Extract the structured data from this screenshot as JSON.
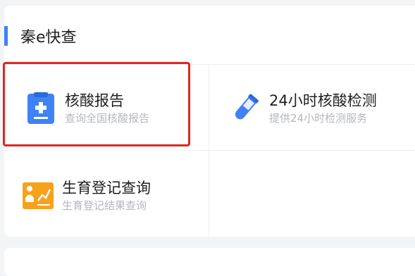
{
  "section": {
    "title": "秦e快查"
  },
  "services": [
    {
      "title": "核酸报告",
      "subtitle": "查询全国核酸报告",
      "icon": "clipboard-medical-icon",
      "color": "#3f82f7"
    },
    {
      "title": "24小时核酸检测",
      "subtitle": "提供24小时检测服务",
      "icon": "test-tube-icon",
      "color": "#3f82f7"
    },
    {
      "title": "生育登记查询",
      "subtitle": "生育登记结果查询",
      "icon": "presentation-board-icon",
      "color": "#f7a21b"
    }
  ],
  "colors": {
    "accent": "#3f82f7",
    "highlight": "#e0261f"
  }
}
